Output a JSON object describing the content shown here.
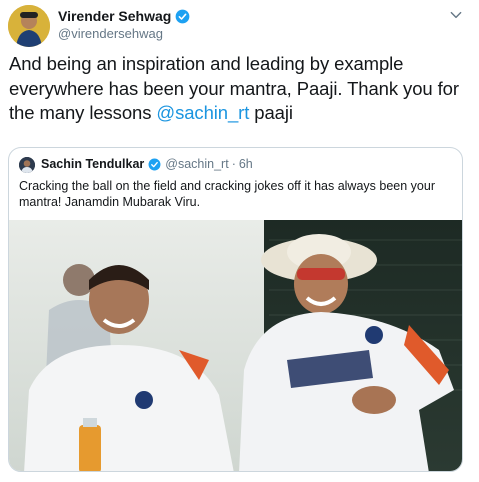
{
  "tweet": {
    "author_name": "Virender Sehwag",
    "author_handle": "@virendersehwag",
    "text_part1": "And being an inspiration and leading by example everywhere has been your mantra, Paaji. Thank you for the many lessons ",
    "mention": "@sachin_rt",
    "text_part2": " paaji",
    "icons": {
      "verified": "verified-badge-icon",
      "menu": "chevron-down-icon"
    }
  },
  "quoted_tweet": {
    "author_name": "Sachin Tendulkar",
    "author_handle": "@sachin_rt",
    "separator": "·",
    "time": "6h",
    "text": "Cracking the ball on the field and cracking jokes off it has always been your mantra! Janamdin Mubarak Viru."
  },
  "colors": {
    "link": "#1b95e0",
    "verified": "#1da1f2",
    "secondary_text": "#657786",
    "border": "#ccd6dd"
  }
}
